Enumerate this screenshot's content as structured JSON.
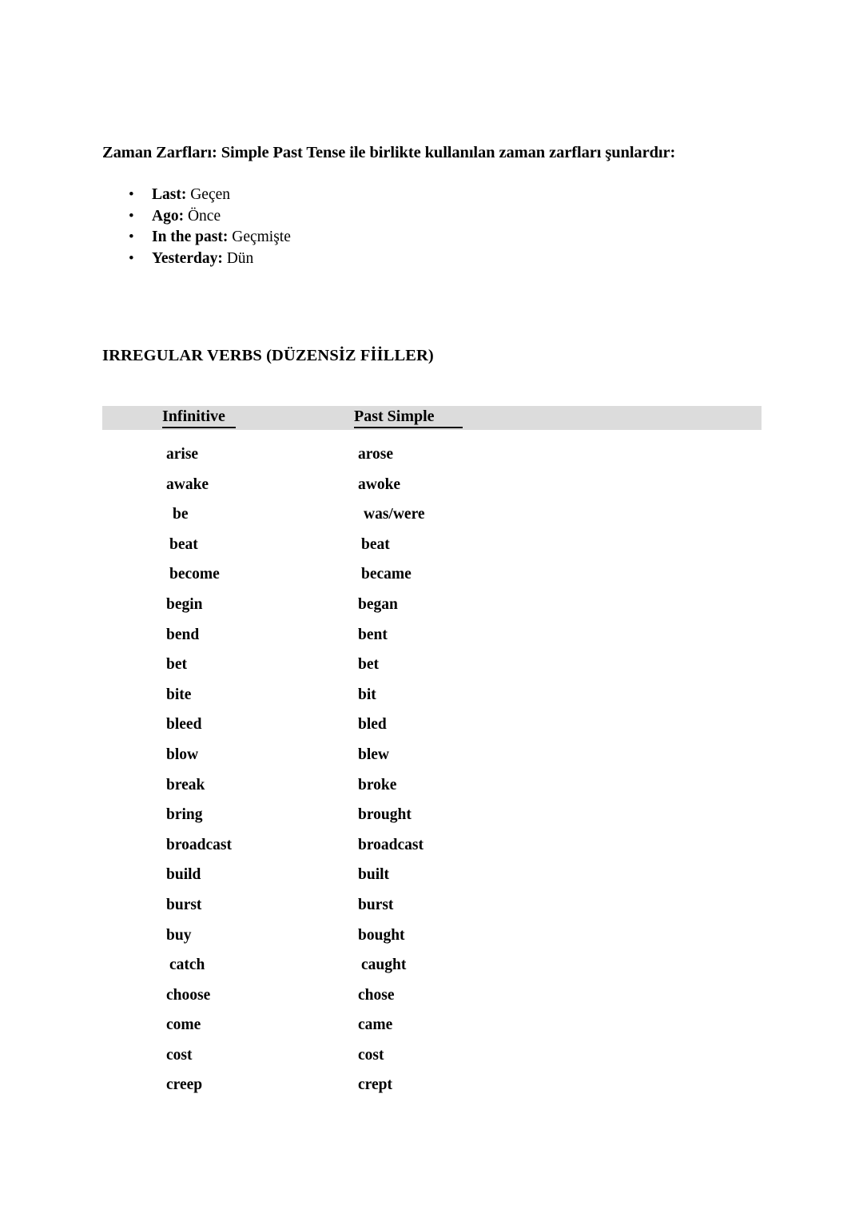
{
  "document": {
    "adverbs_heading": "Zaman Zarfları: Simple Past Tense ile birlikte kullanılan zaman zarfları şunlardır:",
    "adverbs": [
      {
        "bullet": "•",
        "term": "Last:",
        "gloss": " Geçen"
      },
      {
        "bullet": "•",
        "term": "Ago:",
        "gloss": " Önce"
      },
      {
        "bullet": "•",
        "term": "In the past:",
        "gloss": " Geçmişte"
      },
      {
        "bullet": "•",
        "term": "Yesterday:",
        "gloss": " Dün"
      }
    ],
    "verbs_title": "IRREGULAR VERBS (DÜZENSİZ FİİLLER)",
    "table": {
      "header_background": "#dcdcdc",
      "columns": [
        "Infinitive",
        "Past Simple"
      ],
      "rows": [
        {
          "infinitive": "arise",
          "past": "arose"
        },
        {
          "infinitive": "awake",
          "past": "awoke"
        },
        {
          "infinitive": "be",
          "past": "was/were"
        },
        {
          "infinitive": "beat",
          "past": "beat"
        },
        {
          "infinitive": "become",
          "past": "became"
        },
        {
          "infinitive": "begin",
          "past": "began"
        },
        {
          "infinitive": "bend",
          "past": "bent"
        },
        {
          "infinitive": "bet",
          "past": "bet"
        },
        {
          "infinitive": "bite",
          "past": "bit"
        },
        {
          "infinitive": "bleed",
          "past": "bled"
        },
        {
          "infinitive": "blow",
          "past": "blew"
        },
        {
          "infinitive": "break",
          "past": "broke"
        },
        {
          "infinitive": "bring",
          "past": "brought"
        },
        {
          "infinitive": "broadcast",
          "past": "broadcast"
        },
        {
          "infinitive": "build",
          "past": "built"
        },
        {
          "infinitive": "burst",
          "past": "burst"
        },
        {
          "infinitive": "buy",
          "past": "bought"
        },
        {
          "infinitive": "catch",
          "past": "caught"
        },
        {
          "infinitive": "choose",
          "past": "chose"
        },
        {
          "infinitive": "come",
          "past": "came"
        },
        {
          "infinitive": "cost",
          "past": "cost"
        },
        {
          "infinitive": "creep",
          "past": "crept"
        }
      ]
    }
  }
}
